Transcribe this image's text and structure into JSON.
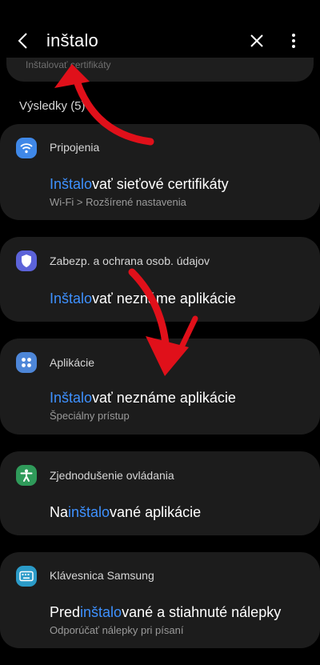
{
  "search": {
    "query": "inštalo",
    "prev_item_partial": "Inštalovať certifikáty"
  },
  "results": {
    "label": "Výsledky (5)"
  },
  "colors": {
    "highlight": "#3e91ff",
    "card": "#1c1c1c",
    "annotation_arrow": "#e0101a"
  },
  "items": [
    {
      "category": "Pripojenia",
      "icon": "wifi-icon",
      "icon_color": "#3f88e8",
      "title": {
        "pre": "",
        "match": "Inštalo",
        "post": "vať sieťové certifikáty"
      },
      "subtitle": "Wi-Fi > Rozšírené nastavenia"
    },
    {
      "category": "Zabezp. a ochrana osob. údajov",
      "icon": "shield-icon",
      "icon_color": "#5c63d9",
      "title": {
        "pre": "",
        "match": "Inštalo",
        "post": "vať neznáme aplikácie"
      },
      "subtitle": ""
    },
    {
      "category": "Aplikácie",
      "icon": "apps-grid-icon",
      "icon_color": "#4d86d8",
      "title": {
        "pre": "",
        "match": "Inštalo",
        "post": "vať neznáme aplikácie"
      },
      "subtitle": "Špeciálny prístup"
    },
    {
      "category": "Zjednodušenie ovládania",
      "icon": "accessibility-icon",
      "icon_color": "#2f9a5a",
      "title": {
        "pre": "Na",
        "match": "inštalo",
        "post": "vané aplikácie"
      },
      "subtitle": ""
    },
    {
      "category": "Klávesnica Samsung",
      "icon": "keyboard-icon",
      "icon_color": "#2b9bc8",
      "title": {
        "pre": "Pred",
        "match": "inštalo",
        "post": "vané a stiahnuté nálepky"
      },
      "subtitle": "Odporúčať nálepky pri písaní"
    }
  ]
}
